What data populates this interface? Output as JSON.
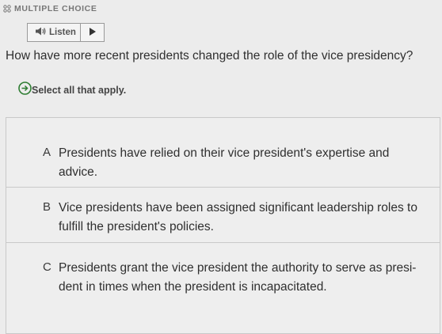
{
  "header": {
    "type_label": "MULTIPLE CHOICE",
    "type_icon": "grid-icon"
  },
  "listen": {
    "label": "Listen",
    "speaker_icon": "speaker-icon",
    "play_icon": "play-icon"
  },
  "question": {
    "text": "How have more recent presidents changed the role of the vice presidency?"
  },
  "instruction": {
    "text": "Select all that apply.",
    "icon": "arrow-right-circle-icon"
  },
  "options": [
    {
      "letter": "A",
      "line1": "Presidents have relied on their vice president's expertise and",
      "line2": "advice."
    },
    {
      "letter": "B",
      "line1": "Vice presidents have been assigned significant leadership roles to",
      "line2": "fulfill the president's policies."
    },
    {
      "letter": "C",
      "line1": "Presidents grant the vice president the authority to serve as presi-",
      "line2": "dent in times when the president is incapacitated."
    }
  ],
  "colors": {
    "background": "#ececec",
    "border": "#c9c9c9",
    "accent": "#2e7d32"
  }
}
